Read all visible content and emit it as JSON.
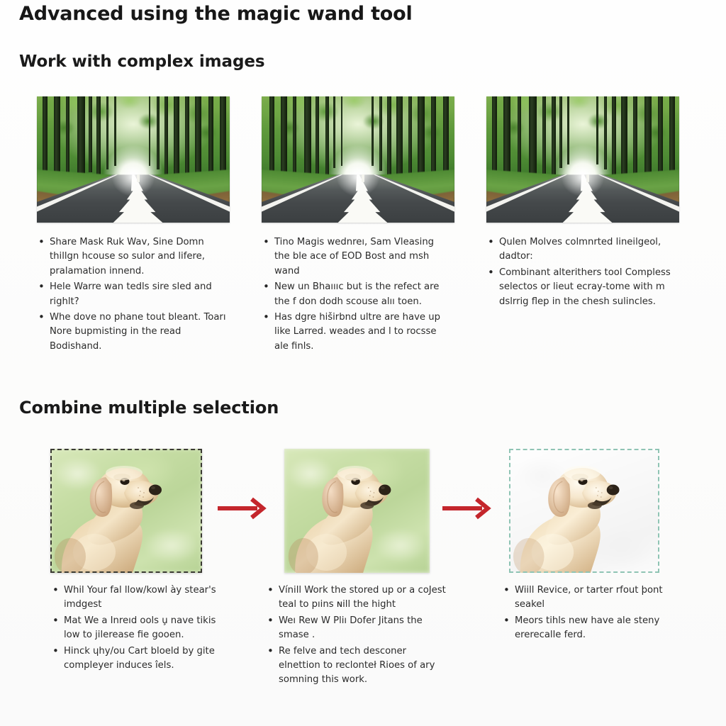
{
  "document": {
    "title": "Advanced using the magic wand tool",
    "background_color": "#fdfdfc",
    "text_color": "#2b2b2b"
  },
  "sections": [
    {
      "id": "work-with-complex-images",
      "heading": "Work with complex images",
      "columns": [
        {
          "image": {
            "name": "forest-road-photo",
            "alt": "Straight asphalt road lined with tall green forest trees"
          },
          "bullets": [
            "Share Mask Ruk Wav, Sine Domn thillgn hcouse so sulor and lifere, pralamation innend.",
            "Hele Warre wan tedls sire sled and righlt?",
            "Whe dove no phane tout bleant. Toarı Nore  bupmisting in the read Bodishand."
          ]
        },
        {
          "image": {
            "name": "forest-road-photo",
            "alt": "Straight asphalt road lined with tall green forest trees"
          },
          "bullets": [
            "Tino Magis wednreı, Sam Vleasing the ble ace of EOD Bost and msh wand",
            "New un Bhaıııc but is the refect are the f don dodh scouse alıı toen.",
            "Has dgre hiširbnd ultre are have up like Larred. weades and l to rocsse ale finls."
          ]
        },
        {
          "image": {
            "name": "forest-road-photo",
            "alt": "Straight asphalt road lined with tall green forest trees"
          },
          "bullets": [
            "Qulen Molves colmnrted lineilgeol, dadtor:",
            "Combinant alterithers tool Compless selectos or lieut ecray-tome with m dslrrig flep in the chesh sulincles."
          ]
        }
      ]
    },
    {
      "id": "combine-multiple-selection",
      "heading": "Combine multiple selection",
      "columns": [
        {
          "image": {
            "name": "dog-photo-selected",
            "alt": "Yellow labrador dog on blurred green grass background",
            "selection": "marching-ants-dashed",
            "selection_color": "#3a3a32",
            "background": "grass"
          },
          "bullets": [
            "Whil Your fal llow/kowl ày stear's imdgest",
            "Mat We a Inreıd ools u̧ nave tikis low to јilerease fie gooen.",
            "Hinck ɥhy/ou Cart bloeld by ɡite compleyer induces îels."
          ]
        },
        {
          "image": {
            "name": "dog-photo-plain",
            "alt": "Yellow labrador dog on blurred green grass background",
            "selection": "none",
            "background": "grass"
          },
          "bullets": [
            "Vínill Work the stored up or a coJest teal to pıins ɴill the hight",
            "Weı Rew W Pliı Dofer Jitans the smase .",
            "Re felve and tech desconer elnettion to reclonteł Rioes of ary somning this work."
          ]
        },
        {
          "image": {
            "name": "dog-photo-extracted",
            "alt": "Yellow labrador dog with background removed on white",
            "selection": "dashed",
            "selection_color": "#8fc4b4",
            "background": "white"
          },
          "bullets": [
            "Wiill Revice, or tarter rfout þont seakel",
            "Meors tihls new have ale steny ererecalle ferd."
          ]
        }
      ],
      "arrows": [
        {
          "name": "transform-arrow-1",
          "color": "#c4262c",
          "direction": "right"
        },
        {
          "name": "transform-arrow-2",
          "color": "#c4262c",
          "direction": "right"
        }
      ]
    }
  ]
}
